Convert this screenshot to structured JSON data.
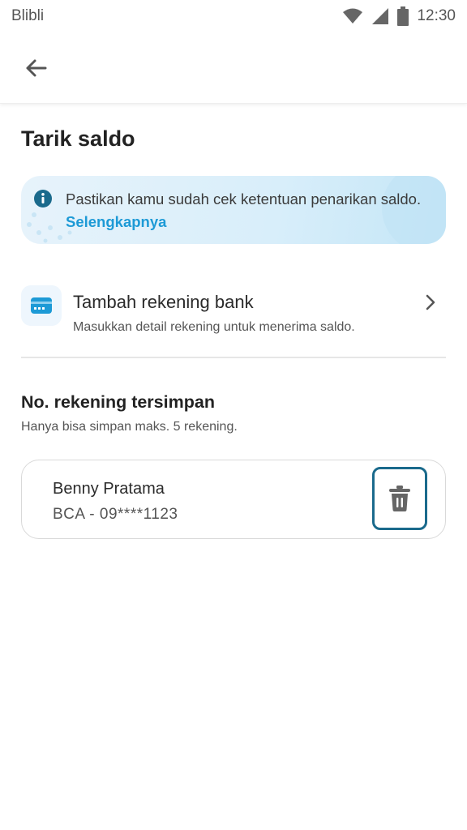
{
  "statusbar": {
    "carrier": "Blibli",
    "time": "12:30"
  },
  "appbar": {
    "back_icon": "arrow-left-icon"
  },
  "page": {
    "title": "Tarik saldo"
  },
  "info_banner": {
    "icon": "info-icon",
    "text": "Pastikan kamu sudah cek ketentuan penarikan saldo.",
    "link": "Selengkapnya",
    "accent": "#1d9ad6"
  },
  "add_bank": {
    "icon": "credit-card-icon",
    "title": "Tambah rekening bank",
    "subtitle": "Masukkan detail rekening untuk menerima saldo."
  },
  "saved_accounts": {
    "title": "No. rekening tersimpan",
    "subtitle": "Hanya bisa simpan maks. 5 rekening.",
    "items": [
      {
        "name": "Benny Pratama",
        "number": "BCA - 09****1123",
        "action_icon": "trash-icon"
      }
    ]
  }
}
